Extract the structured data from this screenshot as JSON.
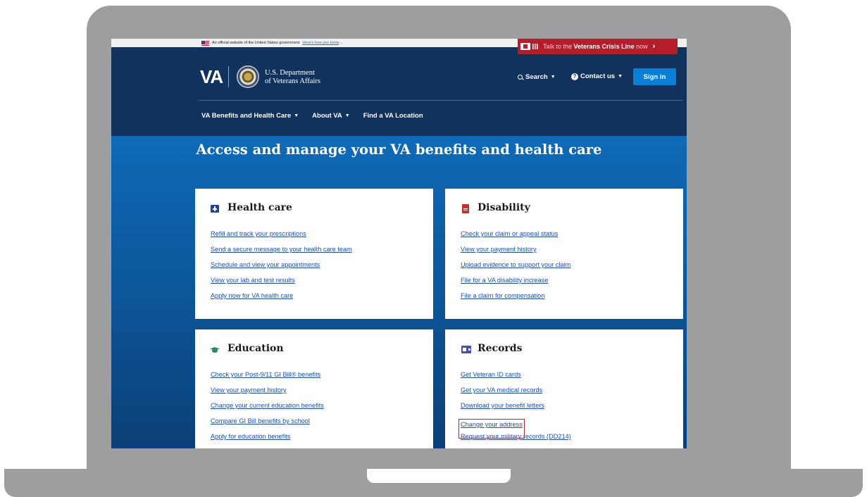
{
  "gov_banner": {
    "text": "An official website of the United States government",
    "link": "Here's how you know"
  },
  "crisis_line": {
    "prefix": "Talk to the ",
    "bold": "Veterans Crisis Line",
    "suffix": " now"
  },
  "header": {
    "logo": "VA",
    "dept_line1": "U.S. Department",
    "dept_line2": "of Veterans Affairs",
    "search": "Search",
    "contact": "Contact us",
    "signin": "Sign in"
  },
  "nav": {
    "items": [
      "VA Benefits and Health Care",
      "About VA",
      "Find a VA Location"
    ]
  },
  "hero": {
    "title": "Access and manage your VA benefits and health care"
  },
  "cards": [
    {
      "title": "Health care",
      "icon": "medical-kit-icon",
      "links": [
        "Refill and track your prescriptions",
        "Send a secure message to your health care team",
        "Schedule and view your appointments",
        "View your lab and test results",
        "Apply now for VA health care"
      ]
    },
    {
      "title": "Disability",
      "icon": "document-icon",
      "links": [
        "Check your claim or appeal status",
        "View your payment history",
        "Upload evidence to support your claim",
        "File for a VA disability increase",
        "File a claim for compensation"
      ]
    },
    {
      "title": "Education",
      "icon": "graduation-cap-icon",
      "links": [
        "Check your Post-9/11 GI Bill® benefits",
        "View your payment history",
        "Change your current education benefits",
        "Compare GI Bill benefits by school",
        "Apply for education benefits"
      ]
    },
    {
      "title": "Records",
      "icon": "id-card-icon",
      "links": [
        "Get Veteran ID cards",
        "Get your VA medical records",
        "Download your benefit letters",
        "Change your address",
        "Request your military records (DD214)"
      ]
    }
  ],
  "colors": {
    "header_bg": "#11325c",
    "hero_bg": "#0e6ab7",
    "crisis_red": "#b51c2c",
    "signin_blue": "#0b7ed6",
    "link_blue": "#1f4fa3",
    "highlight_red": "#b5262e"
  }
}
